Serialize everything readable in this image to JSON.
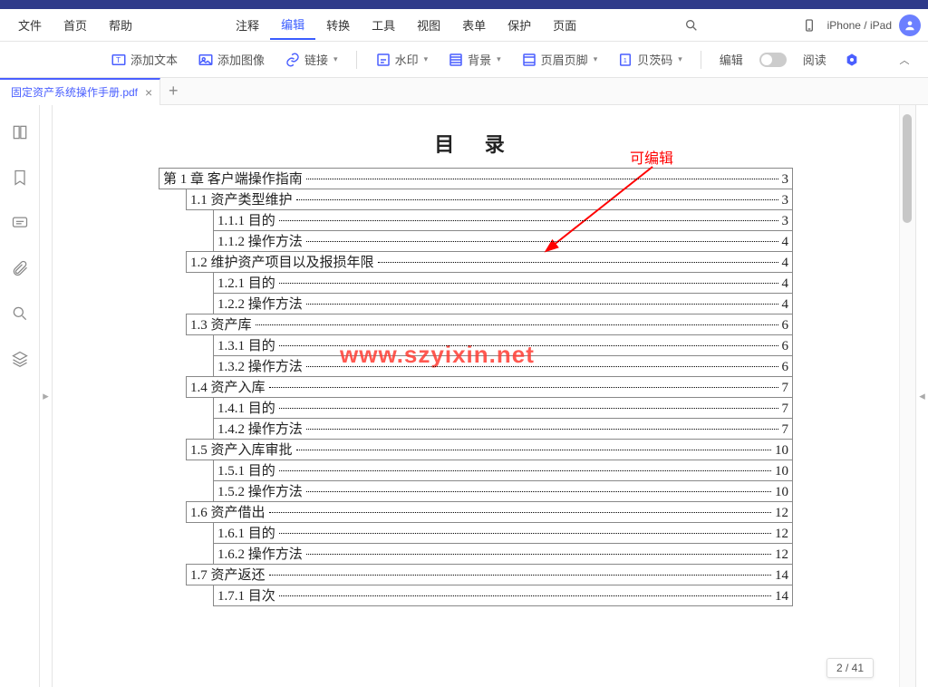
{
  "menubar": {
    "items": [
      "文件",
      "首页",
      "帮助",
      "注释",
      "编辑",
      "转换",
      "工具",
      "视图",
      "表单",
      "保护",
      "页面"
    ],
    "active_index": 4,
    "device_label": "iPhone / iPad"
  },
  "toolbar": {
    "add_text": "添加文本",
    "add_image": "添加图像",
    "link": "链接",
    "watermark": "水印",
    "background": "背景",
    "header_footer": "页眉页脚",
    "page_number": "贝茨码",
    "edit": "编辑",
    "read": "阅读"
  },
  "tabs": {
    "doc_name": "固定资产系统操作手册.pdf"
  },
  "annotation": {
    "label": "可编辑"
  },
  "watermark_text": "www.szyixin.net",
  "page_indicator": {
    "current": 2,
    "total": 41,
    "text": "2 / 41"
  },
  "toc_title": "目 录",
  "toc": [
    {
      "level": 0,
      "label": "第 1 章 客户端操作指南",
      "page": "3"
    },
    {
      "level": 1,
      "label": "1.1 资产类型维护",
      "page": "3"
    },
    {
      "level": 2,
      "label": "1.1.1 目的",
      "page": "3"
    },
    {
      "level": 2,
      "label": "1.1.2 操作方法",
      "page": "4"
    },
    {
      "level": 1,
      "label": "1.2 维护资产项目以及报损年限",
      "page": "4"
    },
    {
      "level": 2,
      "label": "1.2.1 目的",
      "page": "4"
    },
    {
      "level": 2,
      "label": "1.2.2 操作方法",
      "page": "4"
    },
    {
      "level": 1,
      "label": "1.3 资产库",
      "page": "6"
    },
    {
      "level": 2,
      "label": "1.3.1 目的",
      "page": "6"
    },
    {
      "level": 2,
      "label": "1.3.2 操作方法",
      "page": "6"
    },
    {
      "level": 1,
      "label": "1.4 资产入库",
      "page": "7"
    },
    {
      "level": 2,
      "label": "1.4.1 目的",
      "page": "7"
    },
    {
      "level": 2,
      "label": "1.4.2 操作方法",
      "page": "7"
    },
    {
      "level": 1,
      "label": "1.5 资产入库审批",
      "page": "10"
    },
    {
      "level": 2,
      "label": "1.5.1 目的",
      "page": "10"
    },
    {
      "level": 2,
      "label": "1.5.2 操作方法",
      "page": "10"
    },
    {
      "level": 1,
      "label": "1.6 资产借出",
      "page": "12"
    },
    {
      "level": 2,
      "label": "1.6.1 目的",
      "page": "12"
    },
    {
      "level": 2,
      "label": "1.6.2 操作方法",
      "page": "12"
    },
    {
      "level": 1,
      "label": "1.7 资产返还",
      "page": "14"
    },
    {
      "level": 2,
      "label": "1.7.1 目次",
      "page": "14"
    }
  ]
}
